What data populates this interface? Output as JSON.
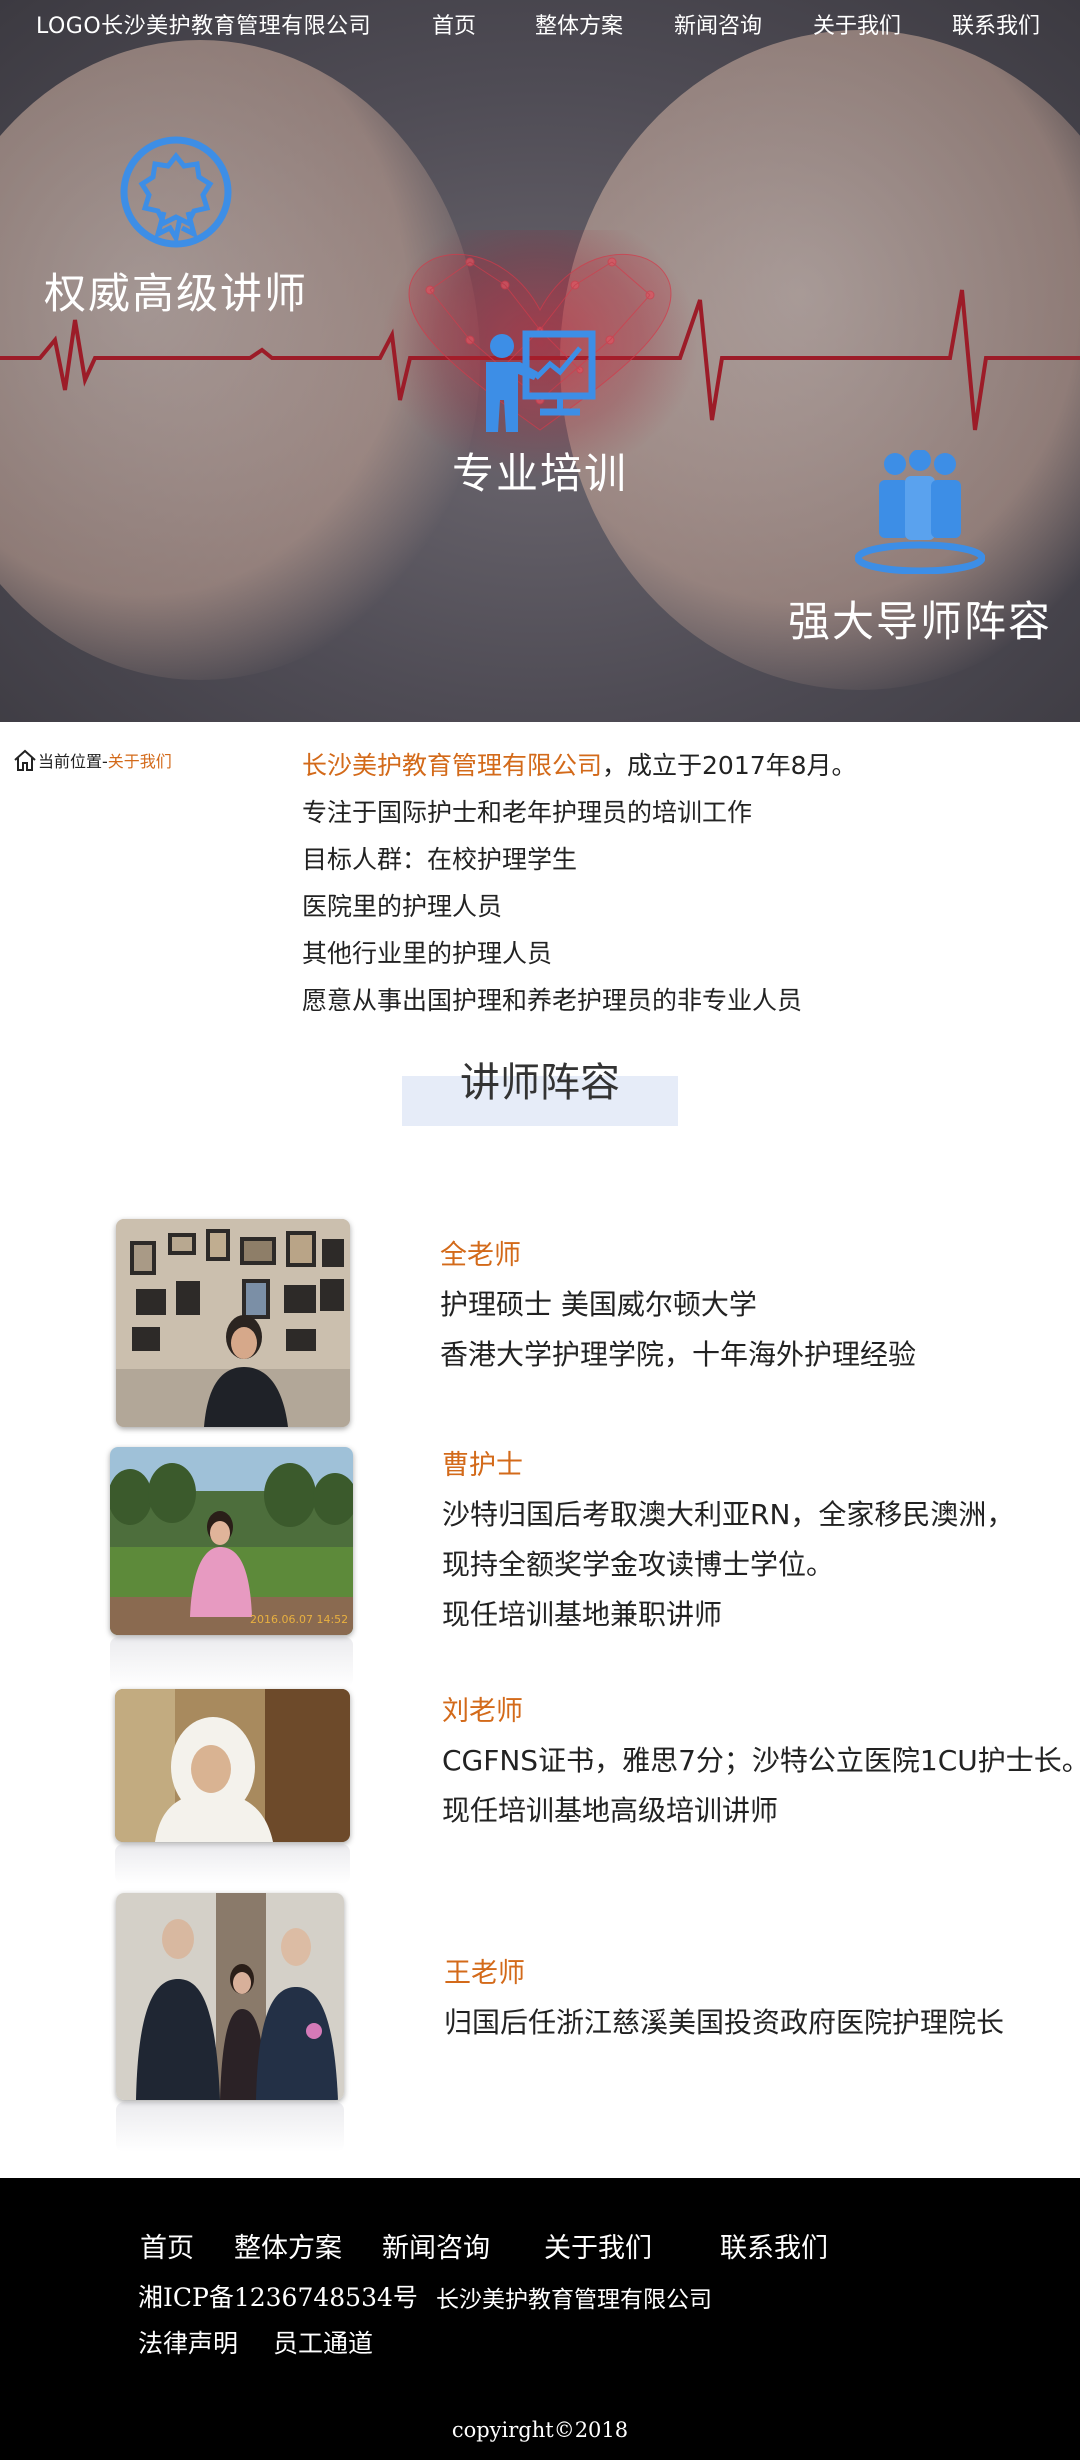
{
  "header": {
    "logo": "LOGO长沙美护教育管理有限公司",
    "nav": [
      "首页",
      "整体方案",
      "新闻咨询",
      "关于我们",
      "联系我们"
    ]
  },
  "hero": {
    "features": [
      {
        "label": "权威高级讲师",
        "icon": "award-badge-icon"
      },
      {
        "label": "专业培训",
        "icon": "teacher-board-icon"
      },
      {
        "label": "强大导师阵容",
        "icon": "team-podium-icon"
      }
    ]
  },
  "breadcrumb": {
    "prefix": "当前位置-",
    "current": "关于我们"
  },
  "about": {
    "company": "长沙美护教育管理有限公司",
    "founded": "，成立于2017年8月。",
    "lines": [
      "专注于国际护士和老年护理员的培训工作",
      "目标人群：在校护理学生",
      "医院里的护理人员",
      "其他行业里的护理人员",
      "愿意从事出国护理和养老护理员的非专业人员"
    ]
  },
  "teachers_section": {
    "title": "讲师阵容",
    "teachers": [
      {
        "name": "全老师",
        "lines": [
          "护理硕士 美国威尔顿大学",
          "香港大学护理学院，十年海外护理经验"
        ]
      },
      {
        "name": "曹护士",
        "lines": [
          "沙特归国后考取澳大利亚RN，全家移民澳洲，",
          "现持全额奖学金攻读博士学位。",
          "现任培训基地兼职讲师"
        ],
        "photo_caption": "2016.06.07 14:52"
      },
      {
        "name": "刘老师",
        "lines": [
          "CGFNS证书，雅思7分；沙特公立医院1CU护士长。",
          "现任培训基地高级培训讲师"
        ]
      },
      {
        "name": "王老师",
        "lines": [
          "归国后任浙江慈溪美国投资政府医院护理院长"
        ]
      }
    ]
  },
  "footer": {
    "nav": [
      "首页",
      "整体方案",
      "新闻咨询",
      "关于我们",
      "联系我们"
    ],
    "icp": "湘ICP备1236748534号",
    "company": "长沙美护教育管理有限公司",
    "legal": "法律声明",
    "staff": "员工通道",
    "copyright": "copyirght©2018"
  },
  "colors": {
    "accent": "#d36a1a",
    "icon_blue": "#3d8ee6",
    "footer_bg": "#000000",
    "title_bar": "#e6ecf8"
  }
}
